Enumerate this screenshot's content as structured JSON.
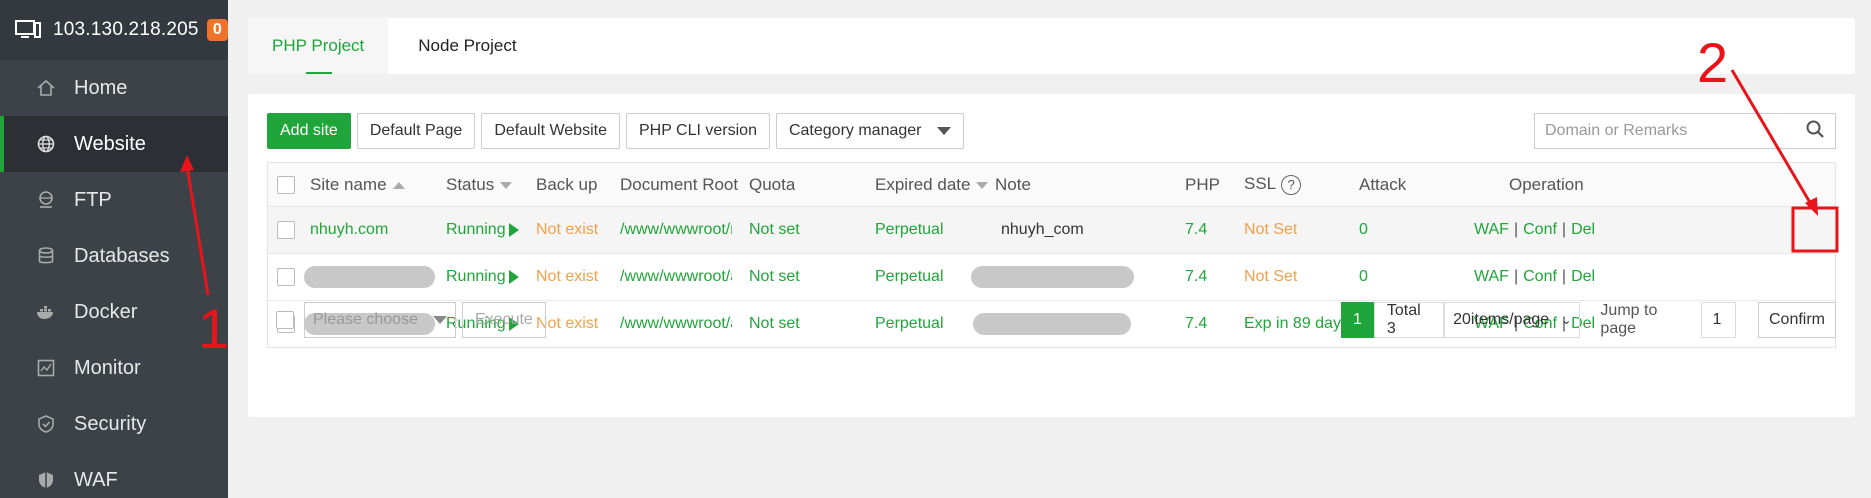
{
  "server": {
    "ip": "103.130.218.205",
    "badge": "0"
  },
  "sidebar": {
    "items": [
      {
        "label": "Home",
        "icon": "home-icon"
      },
      {
        "label": "Website",
        "icon": "globe-icon",
        "active": true
      },
      {
        "label": "FTP",
        "icon": "ftp-icon"
      },
      {
        "label": "Databases",
        "icon": "database-icon"
      },
      {
        "label": "Docker",
        "icon": "docker-icon"
      },
      {
        "label": "Monitor",
        "icon": "monitor-icon"
      },
      {
        "label": "Security",
        "icon": "shield-icon"
      },
      {
        "label": "WAF",
        "icon": "waf-shield-icon"
      }
    ]
  },
  "tabs": [
    {
      "label": "PHP Project",
      "active": true
    },
    {
      "label": "Node Project",
      "active": false
    }
  ],
  "toolbar": {
    "add_site": "Add site",
    "default_page": "Default Page",
    "default_website": "Default Website",
    "php_cli": "PHP CLI version",
    "category_manager": "Category manager"
  },
  "search": {
    "placeholder": "Domain or Remarks"
  },
  "table": {
    "headers": {
      "site_name": "Site name",
      "status": "Status",
      "backup": "Back up",
      "doc_root": "Document Root",
      "quota": "Quota",
      "expired": "Expired date",
      "note": "Note",
      "php": "PHP",
      "ssl": "SSL",
      "attack": "Attack",
      "operation": "Operation"
    },
    "rows": [
      {
        "site": "nhuyh.com",
        "status": "Running",
        "backup": "Not exist",
        "root": "/www/wwwroot/nh",
        "quota": "Not set",
        "expired": "Perpetual",
        "note": "nhuyh_com",
        "php": "7.4",
        "ssl": "Not Set",
        "attack": "0",
        "op_waf": "WAF",
        "op_conf": "Conf",
        "op_del": "Del"
      },
      {
        "site": "",
        "status": "Running",
        "backup": "Not exist",
        "root": "/www/wwwroot/ak",
        "quota": "Not set",
        "expired": "Perpetual",
        "note": "",
        "php": "7.4",
        "ssl": "Not Set",
        "attack": "0",
        "op_waf": "WAF",
        "op_conf": "Conf",
        "op_del": "Del"
      },
      {
        "site": "",
        "status": "Running",
        "backup": "Not exist",
        "root": "/www/wwwroot/ak",
        "quota": "Not set",
        "expired": "Perpetual",
        "note": "",
        "php": "7.4",
        "ssl": "Exp in 89 days",
        "attack": "0",
        "op_waf": "WAF",
        "op_conf": "Conf",
        "op_del": "Del"
      }
    ]
  },
  "footer": {
    "batch_placeholder": "Please choose",
    "execute": "Execute",
    "current_page": "1",
    "total": "Total 3",
    "page_size": "20items/page",
    "jump_label": "Jump to page",
    "jump_value": "1",
    "confirm": "Confirm"
  },
  "annotations": {
    "label_1": "1",
    "label_2": "2",
    "color": "#e8141a"
  },
  "colors": {
    "accent": "#20a53a",
    "warning": "#f0a04b",
    "sidebar": "#33393f"
  }
}
